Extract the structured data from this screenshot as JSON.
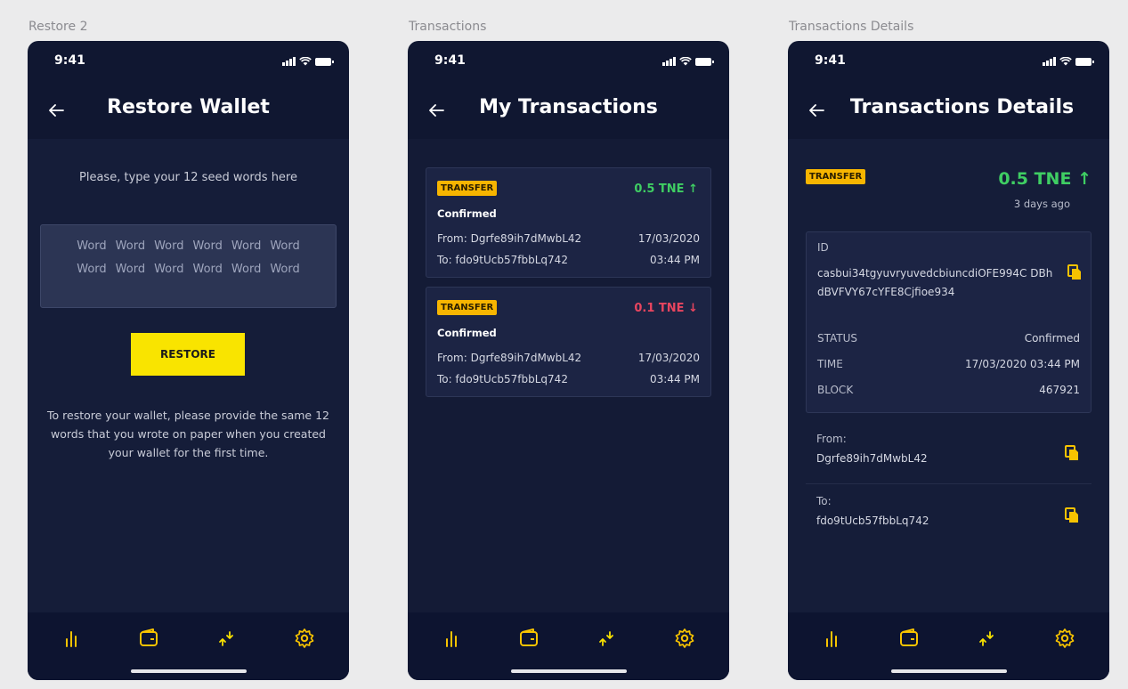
{
  "labels": {
    "restore": "Restore 2",
    "transactions": "Transactions",
    "details": "Transactions Details"
  },
  "status": {
    "time": "9:41"
  },
  "restore": {
    "title": "Restore Wallet",
    "prompt": "Please, type your 12 seed words here",
    "seed_words": [
      "Word",
      "Word",
      "Word",
      "Word",
      "Word",
      "Word",
      "Word",
      "Word",
      "Word",
      "Word",
      "Word",
      "Word"
    ],
    "button": "RESTORE",
    "hint": "To restore your wallet, please provide the same 12 words that you wrote on paper when you created your wallet for the first time."
  },
  "transactions": {
    "title": "My Transactions",
    "items": [
      {
        "badge": "TRANSFER",
        "amount": "0.5 TNE",
        "direction": "up",
        "status": "Confirmed",
        "from": "From: Dgrfe89ih7dMwbL42",
        "to": "To: fdo9tUcb57fbbLq742",
        "date": "17/03/2020",
        "time": "03:44 PM"
      },
      {
        "badge": "TRANSFER",
        "amount": "0.1 TNE",
        "direction": "down",
        "status": "Confirmed",
        "from": "From: Dgrfe89ih7dMwbL42",
        "to": "To: fdo9tUcb57fbbLq742",
        "date": "17/03/2020",
        "time": "03:44 PM"
      }
    ]
  },
  "details": {
    "title": "Transactions Details",
    "badge": "TRANSFER",
    "amount": "0.5 TNE",
    "ago": "3 days ago",
    "id_label": "ID",
    "id_value": "casbui34tgyuvryuvedcbiuncdiOFE994C DBhdBVFVY67cYFE8Cjfioe934",
    "status_label": "STATUS",
    "status_value": "Confirmed",
    "time_label": "TIME",
    "time_value": "17/03/2020 03:44 PM",
    "block_label": "BLOCK",
    "block_value": "467921",
    "from_label": "From:",
    "from_value": "Dgrfe89ih7dMwbL42",
    "to_label": "To:",
    "to_value": "fdo9tUcb57fbbLq742"
  },
  "colors": {
    "accent": "#f9e400",
    "badge": "#f7b500",
    "up": "#3fce63",
    "down": "#e8455f",
    "background": "#101731"
  },
  "icons": {
    "back": "arrow-left-icon",
    "tab1": "bar-chart-icon",
    "tab2": "wallet-icon",
    "tab3": "transfer-arrows-icon",
    "tab4": "gear-icon",
    "copy": "copy-icon"
  }
}
